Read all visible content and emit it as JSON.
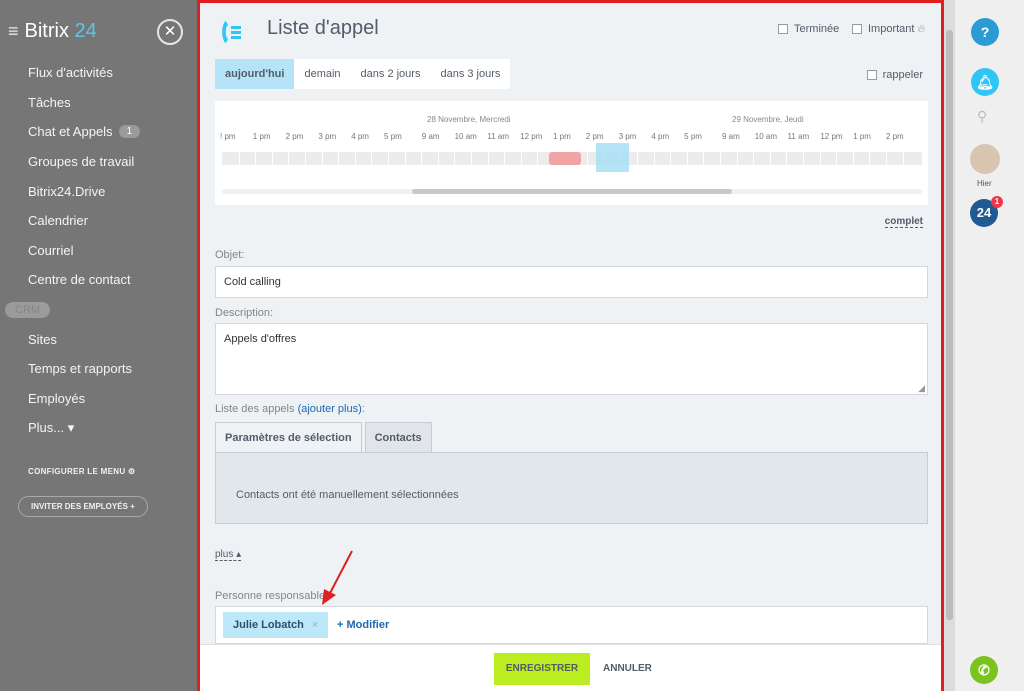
{
  "sidebar": {
    "logo_main": "Bitrix",
    "logo_num": "24",
    "menu": [
      {
        "label": "Flux d'activités"
      },
      {
        "label": "Tâches"
      },
      {
        "label": "Chat et Appels",
        "count": "1"
      },
      {
        "label": "Groupes de travail"
      },
      {
        "label": "Bitrix24.Drive"
      },
      {
        "label": "Calendrier"
      },
      {
        "label": "Courriel"
      },
      {
        "label": "Centre de contact"
      },
      {
        "label": "CRM"
      },
      {
        "label": "Sites"
      },
      {
        "label": "Temps et rapports"
      },
      {
        "label": "Employés"
      },
      {
        "label": "Plus... ▾"
      }
    ],
    "configure": "CONFIGURER LE MENU",
    "invite": "INVITER DES EMPLOYÉS +"
  },
  "header": {
    "title": "Liste d'appel",
    "terminee": "Terminée",
    "important": "Important"
  },
  "day_tabs": [
    "aujourd'hui",
    "demain",
    "dans 2 jours",
    "dans 3 jours"
  ],
  "rappeler": "rappeler",
  "timeline": {
    "day1": "28 Novembre, Mercredi",
    "day2": "29 Novembre, Jeudi",
    "hours": [
      "! pm",
      "1 pm",
      "2 pm",
      "3 pm",
      "4 pm",
      "5 pm",
      "9 am",
      "10 am",
      "11 am",
      "12 pm",
      "1 pm",
      "2 pm",
      "3 pm",
      "4 pm",
      "5 pm",
      "9 am",
      "10 am",
      "11 am",
      "12 pm",
      "1 pm",
      "2 pm"
    ]
  },
  "complet": "complet",
  "form": {
    "objet_label": "Objet:",
    "objet_value": "Cold calling",
    "description_label": "Description:",
    "description_value": "Appels d'offres",
    "liste_label": "Liste des appels",
    "liste_link": "(ajouter plus)",
    "liste_colon": ":",
    "tab_params": "Paramètres de sélection",
    "tab_contacts": "Contacts",
    "selection_text": "Contacts ont été manuellement sélectionnées",
    "plus": "plus ▴",
    "resp_label": "Personne responsable:",
    "resp_name": "Julie Lobatch",
    "modifier": "+ Modifier"
  },
  "footer": {
    "save": "ENREGISTRER",
    "cancel": "ANNULER"
  },
  "right": {
    "help": "?",
    "hier": "Hier",
    "badge24": "24",
    "badge_count": "1"
  }
}
